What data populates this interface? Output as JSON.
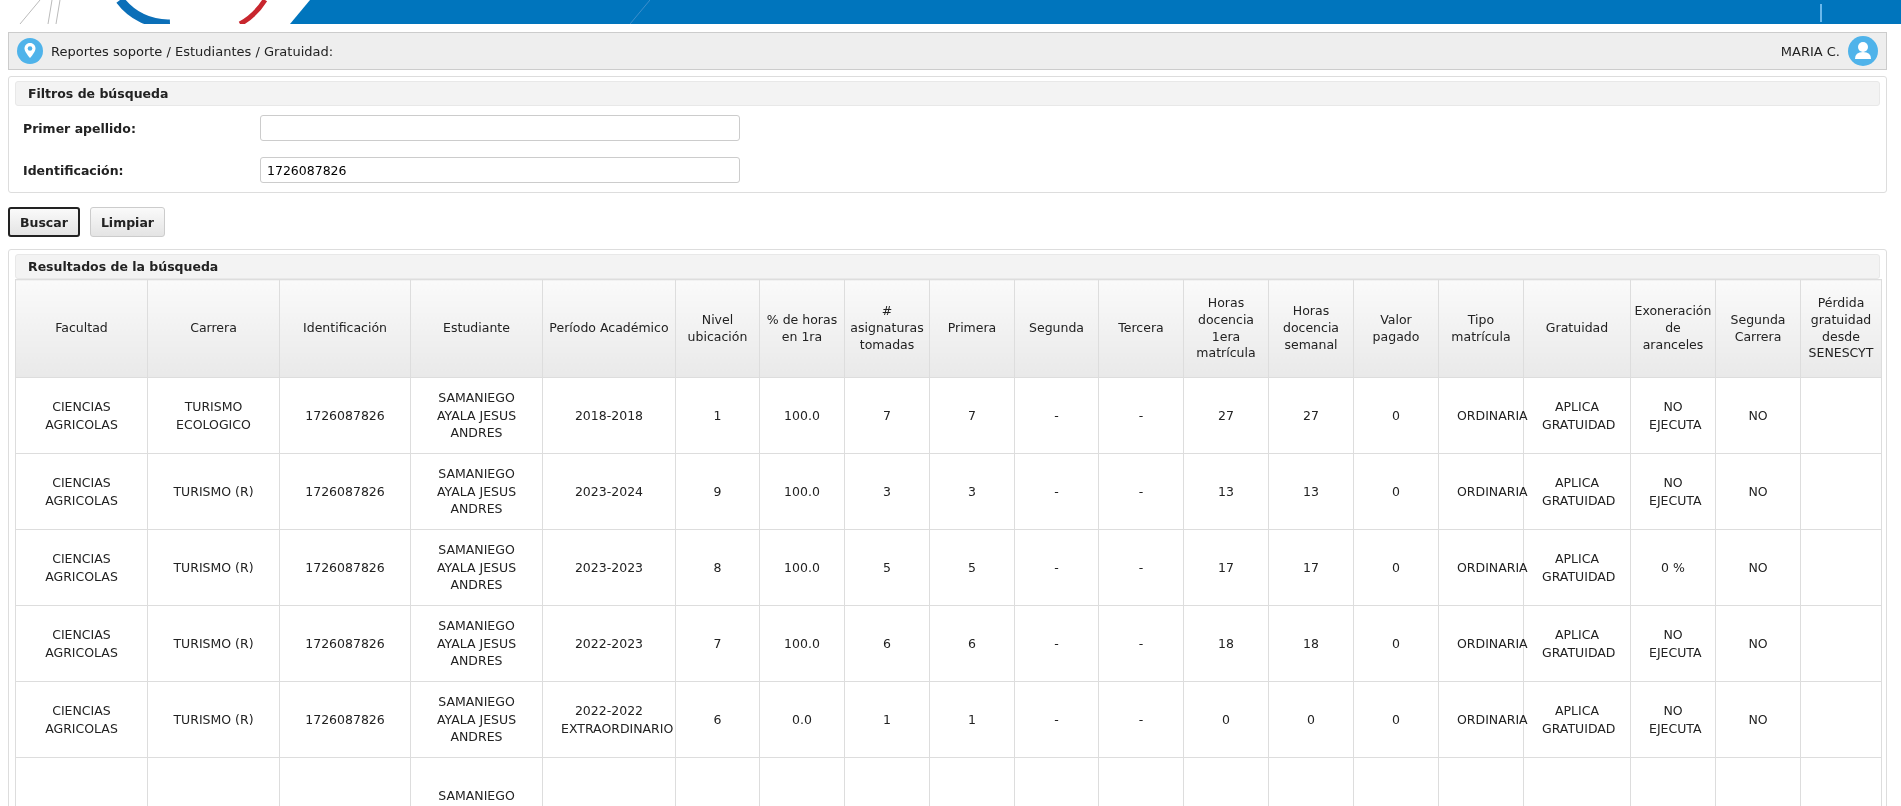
{
  "breadcrumb": {
    "path": "Reportes soporte / Estudiantes / Gratuidad:",
    "user": "MARIA C."
  },
  "filters": {
    "title": "Filtros de búsqueda",
    "fields": [
      {
        "label": "Primer apellido:"
      },
      {
        "label": "Identificación:",
        "value": "1726087826"
      }
    ]
  },
  "buttons": [
    {
      "label": "Buscar",
      "focused": true
    },
    {
      "label": "Limpiar",
      "focused": false
    }
  ],
  "results": {
    "title": "Resultados de la búsqueda",
    "columns": [
      "Facultad",
      "Carrera",
      "Identificación",
      "Estudiante",
      "Período Académico",
      "Nivel ubicación",
      "% de horas en 1ra",
      "# asignaturas tomadas",
      "Primera",
      "Segunda",
      "Tercera",
      "Horas docencia 1era matrícula",
      "Horas docencia semanal",
      "Valor pagado",
      "Tipo matrícula",
      "Gratuidad",
      "Exoneración de aranceles",
      "Segunda Carrera",
      "Pérdida gratuidad desde SENESCYT"
    ],
    "rows": [
      [
        "CIENCIAS AGRICOLAS",
        "TURISMO ECOLOGICO",
        "1726087826",
        "SAMANIEGO AYALA JESUS ANDRES",
        "2018-2018",
        "1",
        "100.0",
        "7",
        "7",
        "-",
        "-",
        "27",
        "27",
        "0",
        "ORDINARIA",
        "APLICA GRATUIDAD",
        "NO EJECUTA",
        "NO",
        null
      ],
      [
        "CIENCIAS AGRICOLAS",
        "TURISMO (R)",
        "1726087826",
        "SAMANIEGO AYALA JESUS ANDRES",
        "2023-2024",
        "9",
        "100.0",
        "3",
        "3",
        "-",
        "-",
        "13",
        "13",
        "0",
        "ORDINARIA",
        "APLICA GRATUIDAD",
        "NO EJECUTA",
        "NO",
        null
      ],
      [
        "CIENCIAS AGRICOLAS",
        "TURISMO (R)",
        "1726087826",
        "SAMANIEGO AYALA JESUS ANDRES",
        "2023-2023",
        "8",
        "100.0",
        "5",
        "5",
        "-",
        "-",
        "17",
        "17",
        "0",
        "ORDINARIA",
        "APLICA GRATUIDAD",
        "0 %",
        "NO",
        null
      ],
      [
        "CIENCIAS AGRICOLAS",
        "TURISMO (R)",
        "1726087826",
        "SAMANIEGO AYALA JESUS ANDRES",
        "2022-2023",
        "7",
        "100.0",
        "6",
        "6",
        "-",
        "-",
        "18",
        "18",
        "0",
        "ORDINARIA",
        "APLICA GRATUIDAD",
        "NO EJECUTA",
        "NO",
        null
      ],
      [
        "CIENCIAS AGRICOLAS",
        "TURISMO (R)",
        "1726087826",
        "SAMANIEGO AYALA JESUS ANDRES",
        "2022-2022 EXTRAORDINARIO",
        "6",
        "0.0",
        "1",
        "1",
        "-",
        "-",
        "0",
        "0",
        "0",
        "ORDINARIA",
        "APLICA GRATUIDAD",
        "NO EJECUTA",
        "NO",
        null
      ],
      [
        null,
        null,
        null,
        "SAMANIEGO",
        null,
        null,
        null,
        null,
        null,
        null,
        null,
        null,
        null,
        null,
        null,
        null,
        null,
        null,
        null
      ]
    ]
  }
}
